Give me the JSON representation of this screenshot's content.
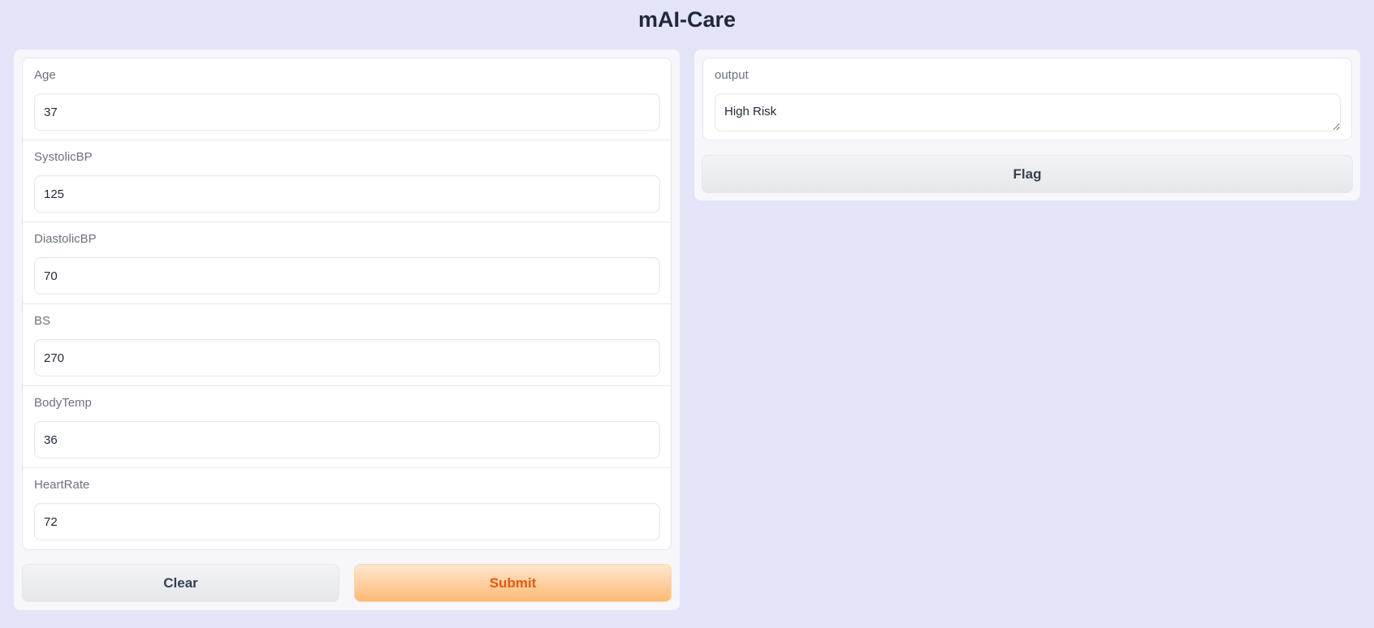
{
  "app": {
    "title": "mAI-Care"
  },
  "inputs": {
    "fields": [
      {
        "label": "Age",
        "value": "37"
      },
      {
        "label": "SystolicBP",
        "value": "125"
      },
      {
        "label": "DiastolicBP",
        "value": "70"
      },
      {
        "label": "BS",
        "value": "270"
      },
      {
        "label": "BodyTemp",
        "value": "36"
      },
      {
        "label": "HeartRate",
        "value": "72"
      }
    ],
    "clear_label": "Clear",
    "submit_label": "Submit"
  },
  "output": {
    "label": "output",
    "value": "High Risk",
    "flag_label": "Flag"
  },
  "colors": {
    "background": "#e4e4f8",
    "panel": "#f6f6fb",
    "submit_text": "#ea580c",
    "submit_gradient_end": "#fdba74"
  }
}
